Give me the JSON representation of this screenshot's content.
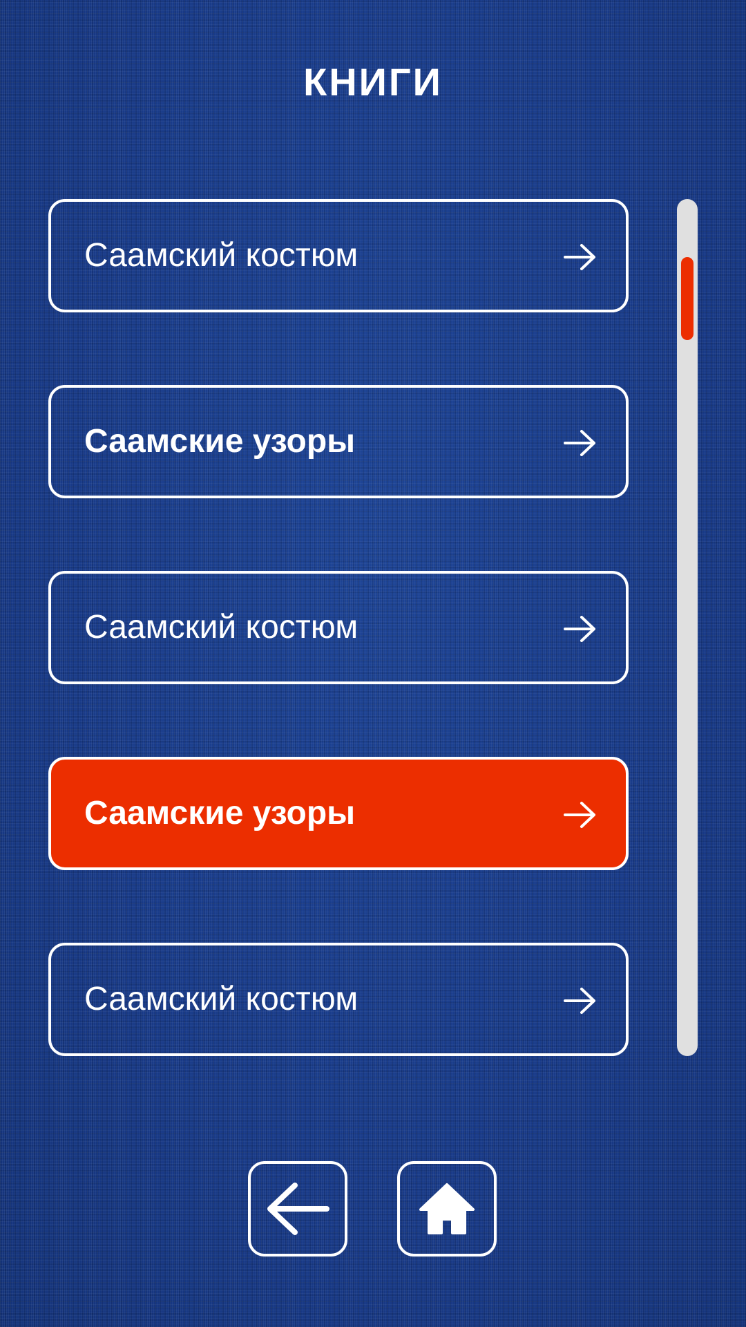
{
  "header": {
    "title": "КНИГИ"
  },
  "books": [
    {
      "label": "Саамский костюм",
      "bold": false,
      "active": false,
      "icon": "arrow-right-icon"
    },
    {
      "label": "Саамские узоры",
      "bold": true,
      "active": false,
      "icon": "arrow-right-icon"
    },
    {
      "label": "Саамский костюм",
      "bold": false,
      "active": false,
      "icon": "arrow-right-icon"
    },
    {
      "label": "Саамские узоры",
      "bold": true,
      "active": true,
      "icon": "arrow-right-icon"
    },
    {
      "label": "Саамский костюм",
      "bold": false,
      "active": false,
      "icon": "arrow-right-icon"
    }
  ],
  "scroll": {
    "position": 0.07
  },
  "nav": {
    "back_icon": "arrow-left-icon",
    "home_icon": "home-icon"
  },
  "colors": {
    "background": "#1a3a86",
    "accent": "#ec2e00",
    "foreground": "#ffffff",
    "scroll_track": "#e0e0e0"
  }
}
